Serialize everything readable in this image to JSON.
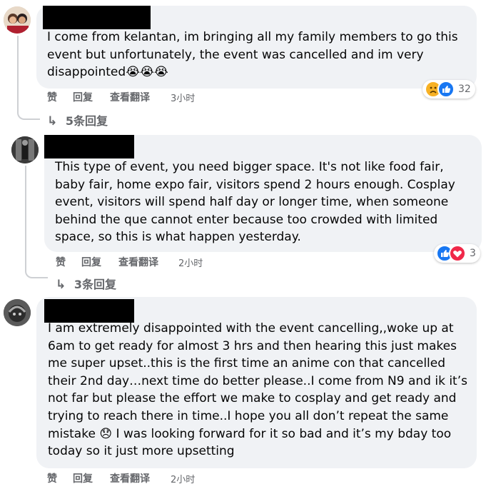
{
  "actions": {
    "like": "赞",
    "reply": "回复",
    "translate": "查看翻译"
  },
  "comments": [
    {
      "text": "I come from kelantan, im bringing all my family members to go this event but unfortunately, the event was cancelled and im very disappointed",
      "emoji_suffix": "😭😭😭",
      "time": "3小时",
      "reaction_count": "32",
      "reaction_icons": [
        "sad-reaction-icon",
        "like-reaction-icon"
      ],
      "replies": "5条回复"
    },
    {
      "text": "This type of event, you need bigger space. It's not like food fair, baby fair, home expo fair, visitors spend 2 hours enough. Cosplay event, visitors will spend half day or longer time, when someone behind the que cannot enter because too crowded with limited space, so this is what happen yesterday.",
      "time": "2小时",
      "reaction_count": "3",
      "reaction_icons": [
        "like-reaction-icon",
        "love-reaction-icon"
      ],
      "replies": "3条回复"
    },
    {
      "text_part1": "I am extremely disappointed with the event cancelling,,woke up at 6am to get ready for almost 3 hrs and then hearing this just makes me super upset..this is the first time an anime con that cancelled their 2nd day…next time do better please..I come from N9 and ik it’s not far but please the effort we make to cosplay and get ready and trying to reach there in time..I hope you all don’t repeat the same mistake ",
      "emoji_mid": "😞",
      "text_part2": " I was looking forward for it so bad and it’s my bday too today so it just more upsetting",
      "time": "2小时"
    }
  ],
  "colors": {
    "bubble": "#f0f2f5",
    "meta": "#65676b",
    "like_blue": "#1877f2",
    "love_red": "#f02849",
    "sad_yellow": "#f7b125"
  }
}
